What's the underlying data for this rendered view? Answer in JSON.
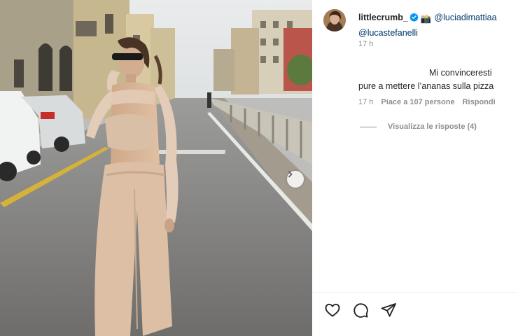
{
  "post": {
    "photo_alt": "",
    "next_icon": "chevron-right-icon"
  },
  "caption": {
    "username": "littlecrumb_",
    "camera_emoji": "📸",
    "mention1": "@luciadimattiaa",
    "mention2": "@lucastefanelli",
    "time": "17 h"
  },
  "comment": {
    "line1": "Mi convinceresti",
    "line2": "pure a mettere l’ananas sulla pizza",
    "time": "17 h",
    "likes": "Piace a 107 persone",
    "reply": "Rispondi"
  },
  "replies": {
    "label": "Visualizza le risposte (4)"
  },
  "colors": {
    "verified": "#0095f6",
    "mention": "#00376b",
    "muted": "#8e8e8e"
  }
}
